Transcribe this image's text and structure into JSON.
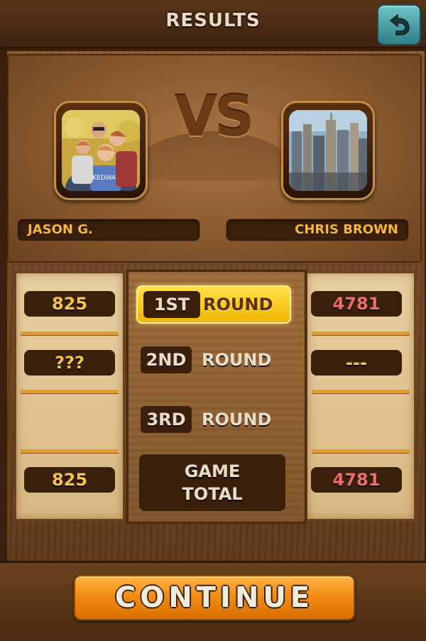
{
  "header": {
    "title": "RESULTS",
    "back_icon": "undo-arrow-icon"
  },
  "versus": {
    "label": "VS"
  },
  "players": [
    {
      "name": "JASON G.",
      "avatar": "family-photo"
    },
    {
      "name": "CHRIS BROWN",
      "avatar": "city-skyline-photo"
    }
  ],
  "rounds": [
    {
      "number": "1ST",
      "word": "ROUND",
      "active": true
    },
    {
      "number": "2ND",
      "word": "ROUND",
      "active": false
    },
    {
      "number": "3RD",
      "word": "ROUND",
      "active": false
    }
  ],
  "game_total": {
    "line1": "GAME",
    "line2": "TOTAL"
  },
  "scores": {
    "player1": {
      "round1": "825",
      "round2": "???",
      "round3": "",
      "total": "825"
    },
    "player2": {
      "round1": "4781",
      "round2": "---",
      "round3": "",
      "total": "4781"
    }
  },
  "footer": {
    "continue_label": "CONTINUE"
  },
  "colors": {
    "accent_gold": "#f5c24a",
    "accent_red": "#f26a6a",
    "button_orange": "#f08a10",
    "active_round": "#ffd21a"
  }
}
